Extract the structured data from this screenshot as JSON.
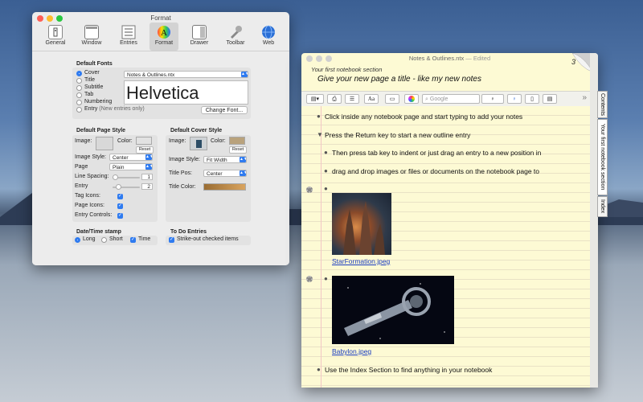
{
  "format_window": {
    "title": "Format",
    "toolbar": [
      {
        "label": "General",
        "icon": "general-icon"
      },
      {
        "label": "Window",
        "icon": "window-icon"
      },
      {
        "label": "Entries",
        "icon": "entries-icon"
      },
      {
        "label": "Format",
        "icon": "format-icon",
        "selected": true
      },
      {
        "label": "Drawer",
        "icon": "drawer-icon"
      },
      {
        "label": "Toolbar",
        "icon": "toolbar-icon"
      },
      {
        "label": "Web",
        "icon": "web-icon"
      }
    ],
    "default_fonts": {
      "title": "Default Fonts",
      "radios": [
        "Cover",
        "Title",
        "Subtitle",
        "Tab",
        "Numbering"
      ],
      "entry_label": "Entry",
      "entry_note": "(New entries only)",
      "selected": "Cover",
      "file_popup": "Notes & Outlines.ntx",
      "preview": "Helvetica",
      "change_font": "Change Font..."
    },
    "page_style": {
      "title": "Default Page Style",
      "image_label": "Image:",
      "color_label": "Color:",
      "reset": "Reset",
      "image_style_label": "Image Style:",
      "image_style": "Center",
      "page_label": "Page",
      "page_value": "Plain",
      "line_spacing_label": "Line Spacing:",
      "line_spacing_value": "1",
      "entry_label": "Entry",
      "entry_value": "2",
      "tag_icons": "Tag Icons:",
      "page_icons": "Page Icons:",
      "entry_controls": "Entry Controls:",
      "swatch_color": "#ffffff"
    },
    "cover_style": {
      "title": "Default Cover Style",
      "image_label": "Image:",
      "color_label": "Color:",
      "reset": "Reset",
      "image_style_label": "Image Style:",
      "image_style": "Fit Width",
      "title_pos_label": "Title Pos:",
      "title_pos": "Center",
      "title_color_label": "Title Color:",
      "swatch_color": "#b9a27c"
    },
    "date_time": {
      "title": "Date/Time stamp",
      "long": "Long",
      "short": "Short",
      "time": "Time"
    },
    "todo": {
      "title": "To Do Entries",
      "strike": "Strike-out checked items"
    }
  },
  "notebook_window": {
    "title": "Notes & Outlines.ntx",
    "edited": "— Edited",
    "section": "Your first notebook section",
    "page_title": "Give your new page a title - like my new notes",
    "page_number": "3",
    "search_placeholder": "Google",
    "entries": [
      "Click inside any notebook page and start typing to add your notes",
      "Press the Return key to start a new outline entry",
      "Then press tab key to indent or just drag an entry to a new position in",
      "drag and drop images or files or documents on the notebook page to",
      "Use the Index Section to find anything in your notebook"
    ],
    "attachments": [
      "StarFormation.jpeg",
      "Babylon.jpeg"
    ],
    "side_tabs": [
      "Contents",
      "Your first notebook section",
      "Index"
    ]
  },
  "colors": {
    "accent": "#2f7bf0",
    "page_yellow": "#fdfad4",
    "link": "#1a3cc0"
  }
}
